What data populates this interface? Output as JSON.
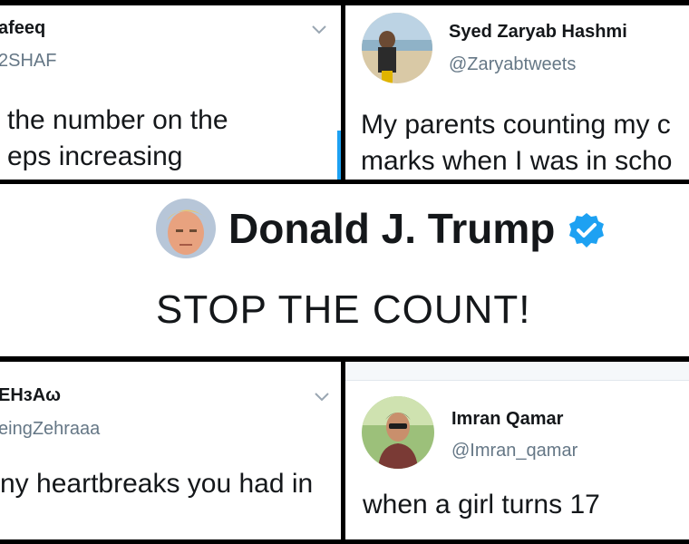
{
  "tweets": {
    "top_left": {
      "name": "afeeq",
      "handle": "2SHAF",
      "line1": "the number on the",
      "line2": "eps increasing"
    },
    "top_right": {
      "name": "Syed Zaryab Hashmi",
      "handle": "@Zaryabtweets",
      "line1": "My parents counting my c",
      "line2": "marks when I was in scho"
    },
    "center": {
      "name": "Donald J. Trump",
      "text": "STOP THE COUNT!"
    },
    "bottom_left": {
      "name": "EHзAω",
      "handle": "eingZehraaa",
      "line1": "ny heartbreaks you had in"
    },
    "bottom_right": {
      "name": "Imran Qamar",
      "handle": "@Imran_qamar",
      "line1": "when a girl turns 17"
    }
  },
  "icons": {
    "dropdown": "chevron-down-icon",
    "verified": "verified-badge-icon"
  },
  "colors": {
    "name": "#14171a",
    "handle": "#657786",
    "verified": "#1da1f2",
    "divider": "#000000"
  }
}
